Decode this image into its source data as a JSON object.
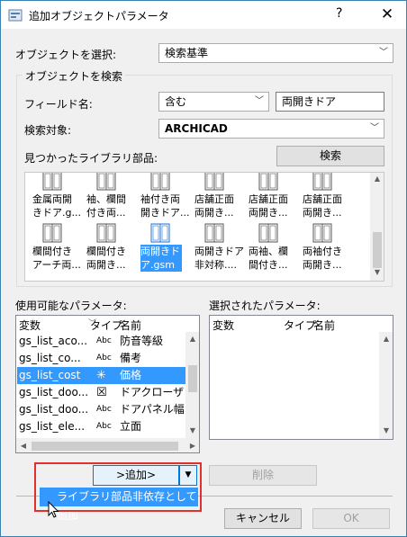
{
  "window": {
    "title": "追加オブジェクトパラメータ",
    "help_label": "?",
    "close_label": "✕"
  },
  "select_object": {
    "label": "オブジェクトを選択:",
    "value": "検索基準"
  },
  "search_group": {
    "title": "オブジェクトを検索",
    "field_label": "フィールド名:",
    "match_value": "含む",
    "search_text": "両開きドア",
    "target_label": "検索対象:",
    "target_value": "ARCHICAD",
    "found_label": "見つかったライブラリ部品:",
    "search_button": "検索"
  },
  "library_items": [
    {
      "caption": "金属両開\nきドア.g..."
    },
    {
      "caption": "袖、欄間\n付き両..."
    },
    {
      "caption": "袖付き両\n開きドア..."
    },
    {
      "caption": "店舗正面\n両開き..."
    },
    {
      "caption": "店舗正面\n両開き..."
    },
    {
      "caption": "店舗正面\n両開き..."
    },
    {
      "caption": "欄間付き\nアーチ両..."
    },
    {
      "caption": "欄間付き\n両開き..."
    },
    {
      "caption": "両開きド\nア.gsm"
    },
    {
      "caption": "両開きドア\n非対称...."
    },
    {
      "caption": "両袖、欄\n間付き..."
    },
    {
      "caption": "両袖付き\n両開き..."
    }
  ],
  "available_params": {
    "label": "使用可能なパラメータ:",
    "columns": {
      "var": "変数",
      "type": "タイプ",
      "name": "名前"
    },
    "rows": [
      {
        "var": "gs_list_aco...",
        "type": "Abc",
        "name": "防音等級"
      },
      {
        "var": "gs_list_co...",
        "type": "Abc",
        "name": "備考"
      },
      {
        "var": "gs_list_cost",
        "type": "✳",
        "name": "価格"
      },
      {
        "var": "gs_list_doo...",
        "type": "☒",
        "name": "ドアクローザ"
      },
      {
        "var": "gs_list_doo...",
        "type": "Abc",
        "name": "ドアパネル幅"
      },
      {
        "var": "gs_list_ele...",
        "type": "Abc",
        "name": "立面"
      }
    ]
  },
  "selected_params": {
    "label": "選択されたパラメータ:",
    "columns": {
      "var": "変数",
      "type": "タイプ",
      "name": "名前"
    }
  },
  "buttons": {
    "add": ">追加>",
    "remove": "削除",
    "cancel": "キャンセル",
    "ok": "OK"
  },
  "add_menu": {
    "item": "ライブラリ部品非依存として追加"
  },
  "colors": {
    "selection": "#3399ff",
    "highlight_border": "#e03030"
  }
}
